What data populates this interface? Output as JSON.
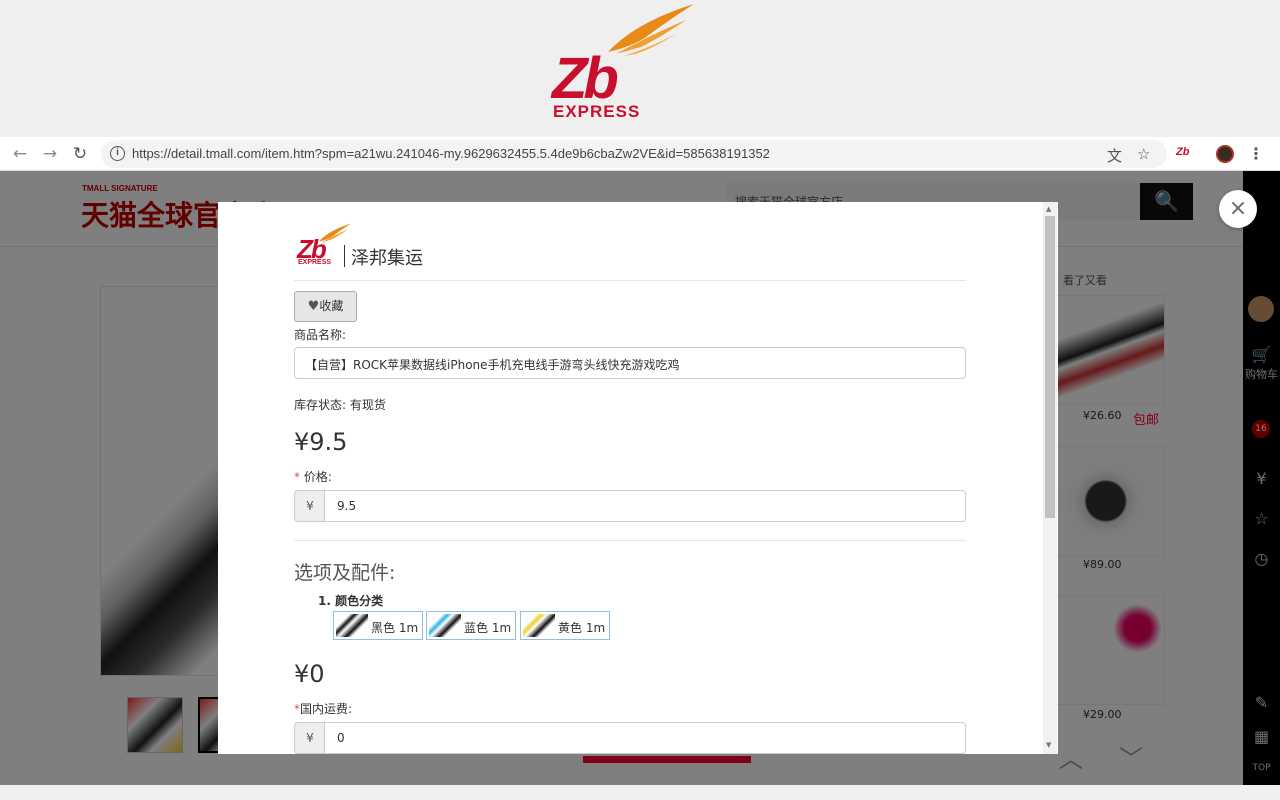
{
  "brand": {
    "logo_text": "Zb",
    "logo_subtext": "EXPRESS",
    "logo_color": "#c8102e"
  },
  "browser": {
    "url": "https://detail.tmall.com/item.htm?spm=a21wu.241046-my.9629632455.5.4de9b6cbaZw2VE&id=585638191352",
    "back_icon": "←",
    "forward_icon": "→",
    "reload_icon": "↻",
    "translate_icon": "文",
    "star_icon": "☆",
    "extension_label": "Zb",
    "menu_icon": "⋮"
  },
  "background_page": {
    "store_signature": "TMALL SIGNATURE",
    "store_name": "天猫全球官方店",
    "search_placeholder": "搜索天猫全球官方店",
    "search_icon": "🔍",
    "side_title": "看了又看",
    "recommendations": [
      {
        "price": "¥26.60"
      },
      {
        "price": "¥89.00"
      },
      {
        "price": "¥29.00"
      }
    ],
    "baoyou": "包邮",
    "chevron_up": "︿",
    "chevron_down": "﹀",
    "toolbar": {
      "cart_icon": "🛒",
      "cart_label": "购物车",
      "cart_count": "16",
      "yen_icon": "¥",
      "star_icon": "☆",
      "history_icon": "◷",
      "edit_icon": "✎",
      "qr_icon": "▦",
      "top_label": "TOP"
    }
  },
  "modal": {
    "close_icon": "×",
    "brand_name": "泽邦集运",
    "favorite_label": "收藏",
    "favorite_icon": "♥",
    "product_name_label": "商品名称:",
    "product_name": "【自营】ROCK苹果数据线iPhone手机充电线手游弯头线快充游戏吃鸡",
    "stock_status": "库存状态: 有现货",
    "price_display": "¥9.5",
    "required_mark": "*",
    "price_label": "价格:",
    "currency_symbol": "¥",
    "price_value": "9.5",
    "options_title": "选项及配件:",
    "option_group": "1. 颜色分类",
    "options": [
      {
        "label": "黑色  1m"
      },
      {
        "label": "蓝色  1m"
      },
      {
        "label": "黄色  1m"
      }
    ],
    "shipping_display": "¥0",
    "shipping_label": "国内运费:",
    "shipping_value": "0"
  }
}
